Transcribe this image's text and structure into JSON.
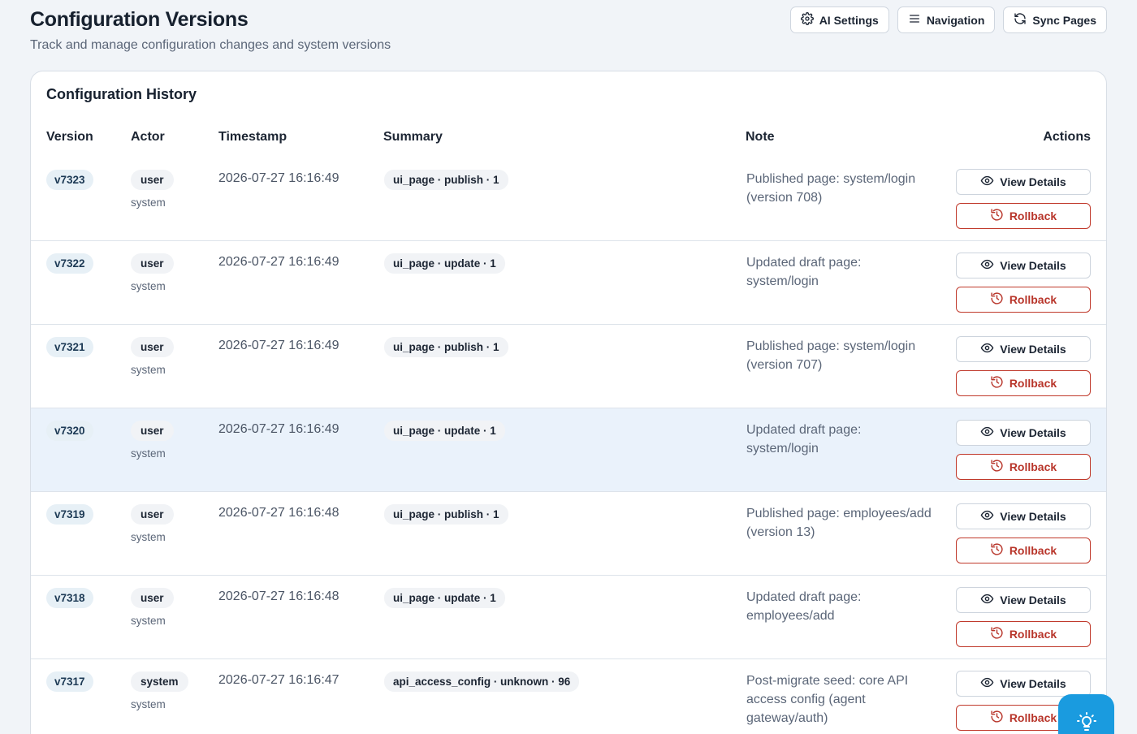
{
  "header": {
    "title": "Configuration Versions",
    "subtitle": "Track and manage configuration changes and system versions"
  },
  "toolbar": {
    "buttons": [
      {
        "label": "AI Settings",
        "icon": "gear-icon"
      },
      {
        "label": "Navigation",
        "icon": "menu-icon"
      },
      {
        "label": "Sync Pages",
        "icon": "sync-icon"
      }
    ]
  },
  "history": {
    "title": "Configuration History",
    "columns": {
      "version": "Version",
      "actor": "Actor",
      "timestamp": "Timestamp",
      "summary": "Summary",
      "note": "Note",
      "actions": "Actions"
    },
    "view_label": "View Details",
    "rollback_label": "Rollback",
    "rows": [
      {
        "version": "v7323",
        "actor": "user",
        "actor_sub": "system",
        "timestamp": "2026-07-27 16:16:49",
        "summary": "ui_page · publish · 1",
        "note": "Published page: system/login (version 708)"
      },
      {
        "version": "v7322",
        "actor": "user",
        "actor_sub": "system",
        "timestamp": "2026-07-27 16:16:49",
        "summary": "ui_page · update · 1",
        "note": "Updated draft page: system/login"
      },
      {
        "version": "v7321",
        "actor": "user",
        "actor_sub": "system",
        "timestamp": "2026-07-27 16:16:49",
        "summary": "ui_page · publish · 1",
        "note": "Published page: system/login (version 707)"
      },
      {
        "version": "v7320",
        "actor": "user",
        "actor_sub": "system",
        "timestamp": "2026-07-27 16:16:49",
        "summary": "ui_page · update · 1",
        "note": "Updated draft page: system/login",
        "highlighted": true
      },
      {
        "version": "v7319",
        "actor": "user",
        "actor_sub": "system",
        "timestamp": "2026-07-27 16:16:48",
        "summary": "ui_page · publish · 1",
        "note": "Published page: employees/add (version 13)"
      },
      {
        "version": "v7318",
        "actor": "user",
        "actor_sub": "system",
        "timestamp": "2026-07-27 16:16:48",
        "summary": "ui_page · update · 1",
        "note": "Updated draft page: employees/add"
      },
      {
        "version": "v7317",
        "actor": "system",
        "actor_sub": "system",
        "timestamp": "2026-07-27 16:16:47",
        "summary": "api_access_config · unknown · 96",
        "note": "Post-migrate seed: core API access config (agent gateway/auth)"
      }
    ]
  },
  "fab": {
    "icon": "lightbulb-icon"
  },
  "colors": {
    "accent": "#1a9bdf",
    "rollback": "#c0392b",
    "highlight_row": "#eaf2fb"
  }
}
